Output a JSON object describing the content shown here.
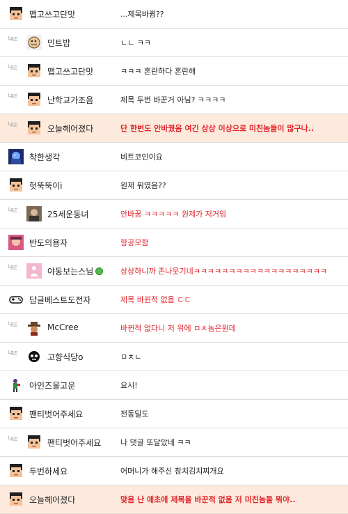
{
  "reply_marker": "└RE",
  "comments": [
    {
      "nick": "맵고쓰고단맛",
      "text": "...제목바뀜??",
      "reply": false,
      "avatar": "pixel-face",
      "red": false,
      "highlight": false
    },
    {
      "nick": "민트밥",
      "text": "ㄴㄴ ㅋㅋ",
      "reply": true,
      "avatar": "cookie",
      "red": false,
      "highlight": false
    },
    {
      "nick": "맵고쓰고단맛",
      "text": "ㅋㅋㅋ 혼란하다 혼란해",
      "reply": true,
      "avatar": "pixel-face",
      "red": false,
      "highlight": false
    },
    {
      "nick": "난학교가조음",
      "text": "제목 두번 바꾼거 아님? ㅋㅋㅋㅋ",
      "reply": true,
      "avatar": "pixel-face",
      "red": false,
      "highlight": false
    },
    {
      "nick": "오늘헤어졌다",
      "text": "단 한번도 안바꿨음 여긴 상상 이상으로 미친놈들이 많구나..",
      "reply": true,
      "avatar": "pixel-face",
      "red": true,
      "highlight": true
    },
    {
      "nick": "착한생각",
      "text": "비트코인이요",
      "reply": false,
      "avatar": "anime",
      "red": false,
      "highlight": false
    },
    {
      "nick": "헛뚝뚝이i",
      "text": "원제 뭐였음??",
      "reply": false,
      "avatar": "pixel-face",
      "red": false,
      "highlight": false
    },
    {
      "nick": "25세운동녀",
      "text": "안바꿈 ㅋㅋㅋㅋㅋ 원제가 저거임",
      "reply": true,
      "avatar": "photo",
      "red": true,
      "highlight": false
    },
    {
      "nick": "반도의용자",
      "text": "항공모함",
      "reply": false,
      "avatar": "pink",
      "red": true,
      "highlight": false
    },
    {
      "nick": "야동보는스님",
      "text": "상상하니까 존나웃기네ㅋㅋㅋㅋㅋㅋㅋㅋㅋㅋㅋㅋㅋㅋㅋㅋㅋㅋㅋ",
      "reply": true,
      "avatar": "buddha",
      "red": true,
      "highlight": false,
      "online": true
    },
    {
      "nick": "답글베스트도전자",
      "text": "제목 바뀐적 없음 ㄷㄷ",
      "reply": false,
      "avatar": "gamepad",
      "red": true,
      "highlight": false
    },
    {
      "nick": "McCree",
      "text": "바뀐적 없다니 저 위에 ㅁㅊ놈은뭔데",
      "reply": true,
      "avatar": "cowboy",
      "red": true,
      "highlight": false
    },
    {
      "nick": "고향식당o",
      "text": "ㅁㅊㄴ",
      "reply": true,
      "avatar": "bw",
      "red": false,
      "highlight": false
    },
    {
      "nick": "아인즈울고운",
      "text": "요시!",
      "reply": false,
      "avatar": "figure",
      "red": false,
      "highlight": false
    },
    {
      "nick": "팬티벗어주세요",
      "text": "전동딜도",
      "reply": false,
      "avatar": "pixel-face",
      "red": false,
      "highlight": false
    },
    {
      "nick": "팬티벗어주세요",
      "text": "나 댓글 또달았네 ㅋㅋ",
      "reply": true,
      "avatar": "pixel-face",
      "red": false,
      "highlight": false
    },
    {
      "nick": "두번하세요",
      "text": "어머니가 해주신 참치김치찌개요",
      "reply": false,
      "avatar": "pixel-face",
      "red": false,
      "highlight": false
    },
    {
      "nick": "오늘헤어졌다",
      "text": "맞음 난 애초에 제목을 바꾼적 없음 저 미친놈들 뭐야..",
      "reply": false,
      "avatar": "pixel-face",
      "red": true,
      "highlight": true
    }
  ]
}
